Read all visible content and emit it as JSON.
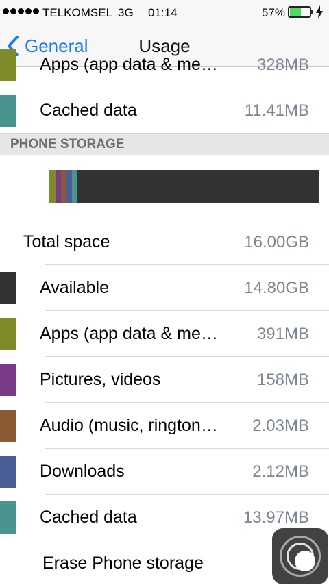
{
  "status_bar": {
    "carrier": "TELKOMSEL",
    "network": "3G",
    "time": "01:14",
    "battery_percent": "57%",
    "battery_level": 0.57
  },
  "nav": {
    "back_label": "General",
    "title": "Usage"
  },
  "top_rows": [
    {
      "label": "Apps (app data & me…",
      "value": "328MB",
      "color": "#7f8a2a"
    },
    {
      "label": "Cached data",
      "value": "11.41MB",
      "color": "#4a9490"
    }
  ],
  "section_header": "PHONE STORAGE",
  "storage_bar": {
    "segments": [
      {
        "name": "apps",
        "color": "#7f8a2a",
        "fraction": 0.024
      },
      {
        "name": "pictures",
        "color": "#7a3b86",
        "fraction": 0.02
      },
      {
        "name": "audio",
        "color": "#8b5a34",
        "fraction": 0.02
      },
      {
        "name": "downloads",
        "color": "#4b5e96",
        "fraction": 0.02
      },
      {
        "name": "cached",
        "color": "#4a9490",
        "fraction": 0.02
      },
      {
        "name": "available",
        "color": "#333333",
        "fraction": 0.896
      }
    ]
  },
  "total_space": {
    "label": "Total space",
    "value": "16.00GB"
  },
  "storage_rows": [
    {
      "label": "Available",
      "value": "14.80GB",
      "color": "#333333"
    },
    {
      "label": "Apps (app data & me…",
      "value": "391MB",
      "color": "#7f8a2a"
    },
    {
      "label": "Pictures, videos",
      "value": "158MB",
      "color": "#7a3b86"
    },
    {
      "label": "Audio (music, rington…",
      "value": "2.03MB",
      "color": "#8b5a34"
    },
    {
      "label": "Downloads",
      "value": "2.12MB",
      "color": "#4b5e96"
    },
    {
      "label": "Cached data",
      "value": "13.97MB",
      "color": "#4a9490"
    }
  ],
  "erase_label": "Erase Phone storage"
}
